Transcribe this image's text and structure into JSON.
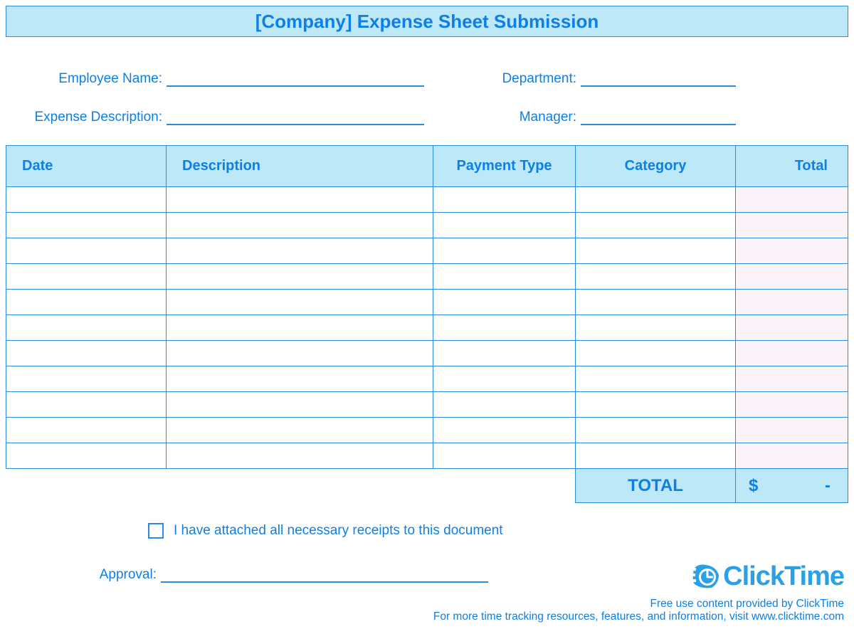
{
  "title": "[Company] Expense Sheet Submission",
  "fields": {
    "employee_name_label": "Employee Name:",
    "employee_name_value": "",
    "department_label": "Department:",
    "department_value": "",
    "expense_desc_label": "Expense Description:",
    "expense_desc_value": "",
    "manager_label": "Manager:",
    "manager_value": ""
  },
  "table": {
    "headers": {
      "date": "Date",
      "description": "Description",
      "payment_type": "Payment Type",
      "category": "Category",
      "total": "Total"
    },
    "rows": [
      {
        "date": "",
        "description": "",
        "payment_type": "",
        "category": "",
        "total": ""
      },
      {
        "date": "",
        "description": "",
        "payment_type": "",
        "category": "",
        "total": ""
      },
      {
        "date": "",
        "description": "",
        "payment_type": "",
        "category": "",
        "total": ""
      },
      {
        "date": "",
        "description": "",
        "payment_type": "",
        "category": "",
        "total": ""
      },
      {
        "date": "",
        "description": "",
        "payment_type": "",
        "category": "",
        "total": ""
      },
      {
        "date": "",
        "description": "",
        "payment_type": "",
        "category": "",
        "total": ""
      },
      {
        "date": "",
        "description": "",
        "payment_type": "",
        "category": "",
        "total": ""
      },
      {
        "date": "",
        "description": "",
        "payment_type": "",
        "category": "",
        "total": ""
      },
      {
        "date": "",
        "description": "",
        "payment_type": "",
        "category": "",
        "total": ""
      },
      {
        "date": "",
        "description": "",
        "payment_type": "",
        "category": "",
        "total": ""
      },
      {
        "date": "",
        "description": "",
        "payment_type": "",
        "category": "",
        "total": ""
      }
    ]
  },
  "totals": {
    "label": "TOTAL",
    "currency": "$",
    "amount": "-"
  },
  "receipts": {
    "checked": false,
    "label": "I have attached all necessary receipts to this document"
  },
  "approval": {
    "label": "Approval:",
    "value": ""
  },
  "footer": {
    "brand": "ClickTime",
    "line1": "Free use content provided by ClickTime",
    "line2": "For more time tracking resources, features, and information, visit www.clicktime.com"
  }
}
